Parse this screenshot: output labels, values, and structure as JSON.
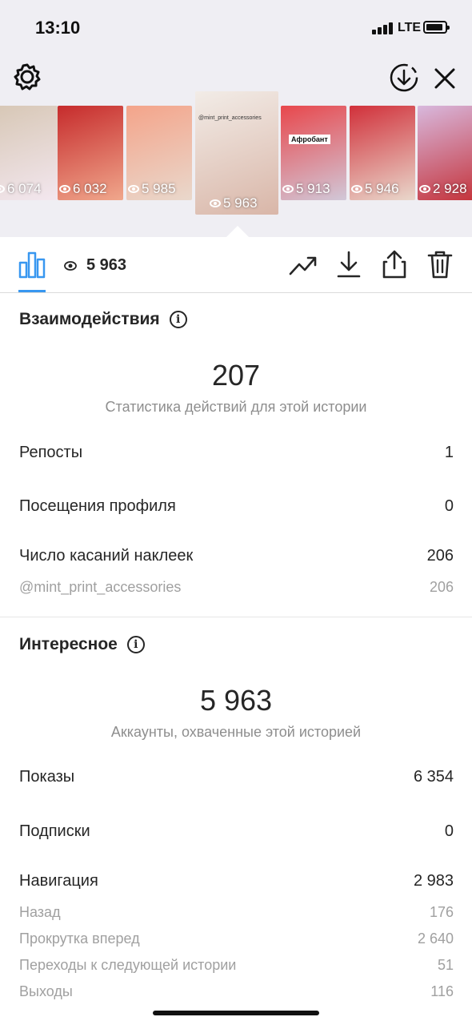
{
  "status_bar": {
    "time": "13:10",
    "network": "LTE"
  },
  "thumbnails": [
    {
      "views": "6 074",
      "colors": [
        "#d7c7b5",
        "#f3e7ef"
      ]
    },
    {
      "views": "6 032",
      "colors": [
        "#c62b2c",
        "#f0a78c"
      ]
    },
    {
      "views": "5 985",
      "colors": [
        "#f4a48a",
        "#e9d8cc"
      ]
    },
    {
      "views": "5 963",
      "colors": [
        "#f2ece7",
        "#d9b6a8"
      ],
      "selected": true,
      "label": "@mint_print_accessories"
    },
    {
      "views": "5 913",
      "colors": [
        "#e8474c",
        "#d1c8d8"
      ],
      "label": "Афробант"
    },
    {
      "views": "5 946",
      "colors": [
        "#d1303a",
        "#e9d8cc"
      ]
    },
    {
      "views": "2 928",
      "colors": [
        "#d8b8dd",
        "#c43138"
      ]
    }
  ],
  "toolbar": {
    "view_count": "5 963"
  },
  "interactions": {
    "title": "Взаимодействия",
    "total": "207",
    "caption": "Статистика действий для этой истории",
    "rows": [
      {
        "label": "Репосты",
        "value": "1"
      },
      {
        "label": "Посещения профиля",
        "value": "0"
      },
      {
        "label": "Число касаний наклеек",
        "value": "206"
      }
    ],
    "sub_rows": [
      {
        "label": "@mint_print_accessories",
        "value": "206"
      }
    ]
  },
  "discovery": {
    "title": "Интересное",
    "total": "5 963",
    "caption": "Аккаунты, охваченные этой историей",
    "rows": [
      {
        "label": "Показы",
        "value": "6 354"
      },
      {
        "label": "Подписки",
        "value": "0"
      },
      {
        "label": "Навигация",
        "value": "2 983"
      }
    ],
    "sub_rows": [
      {
        "label": "Назад",
        "value": "176"
      },
      {
        "label": "Прокрутка вперед",
        "value": "2 640"
      },
      {
        "label": "Переходы к следующей истории",
        "value": "51"
      },
      {
        "label": "Выходы",
        "value": "116"
      }
    ]
  },
  "accent_color": "#3897f0"
}
